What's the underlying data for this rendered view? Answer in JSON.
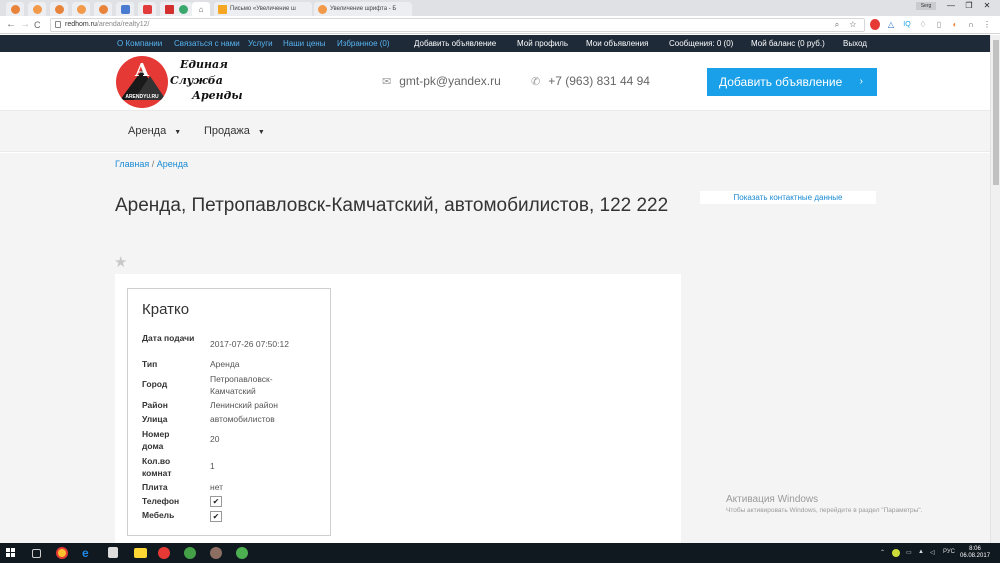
{
  "browser": {
    "tabs": [
      {
        "label": "Письмо «Увеличение ш"
      },
      {
        "label": "Увеличение шрифта - Б"
      }
    ],
    "profile_badge": "Serg",
    "window_controls": {
      "minimize": "—",
      "maximize": "❐",
      "close": "✕"
    },
    "url_host": "redhom.ru",
    "url_path": "/arenda/realty12/",
    "nav": {
      "back": "←",
      "forward": "→",
      "reload": "C"
    },
    "url_actions": "⌕ ☆"
  },
  "site_top_nav": {
    "left_links": [
      "О Компании",
      "Связаться с нами",
      "Услуги",
      "Наши цены",
      "Избранное (0)"
    ],
    "right_links": [
      "Добавить объявление",
      "Мой профиль",
      "Мои объявления",
      "Сообщения: 0 (0)",
      "Мой баланс (0 руб.)",
      "Выход"
    ]
  },
  "header": {
    "logo_letter": "A",
    "logo_sub": "ARENDYU.RU",
    "logo_lines": [
      "Единая",
      "Служба",
      "Аренды"
    ],
    "email": "gmt-pk@yandex.ru",
    "phone": "+7 (963) 831 44 94",
    "add_button": "Добавить объявление"
  },
  "menu": {
    "items": [
      "Аренда",
      "Продажа"
    ]
  },
  "breadcrumb": {
    "home": "Главная",
    "separator": " / ",
    "current": "Аренда"
  },
  "page": {
    "title": "Аренда, Петропавловск-Камчатский, автомобилистов, 122 222",
    "show_contacts": "Показать контактные данные"
  },
  "summary": {
    "heading": "Кратко",
    "rows": [
      {
        "label": "Дата подачи",
        "value": "2017-07-26 07:50:12"
      },
      {
        "label": "Тип",
        "value": "Аренда"
      },
      {
        "label": "Город",
        "value": "Петропавловск-Камчатский"
      },
      {
        "label": "Район",
        "value": "Ленинский район"
      },
      {
        "label": "Улица",
        "value": "автомобилистов"
      },
      {
        "label": "Номер дома",
        "value": "20"
      },
      {
        "label": "Кол.во комнат",
        "value": "1"
      },
      {
        "label": "Плита",
        "value": "нет"
      },
      {
        "label": "Телефон",
        "checked": true
      },
      {
        "label": "Мебель",
        "checked": true
      }
    ]
  },
  "windows_activation": {
    "title": "Активация Windows",
    "subtitle": "Чтобы активировать Windows, перейдите в раздел \"Параметры\"."
  },
  "taskbar": {
    "lang": "РУС",
    "time": "8:06",
    "date": "06.08.2017"
  },
  "colors": {
    "accent": "#1aa0e8",
    "top_bar": "#1e2a38",
    "link": "#1a8ad4",
    "logo_red": "#e53935"
  }
}
